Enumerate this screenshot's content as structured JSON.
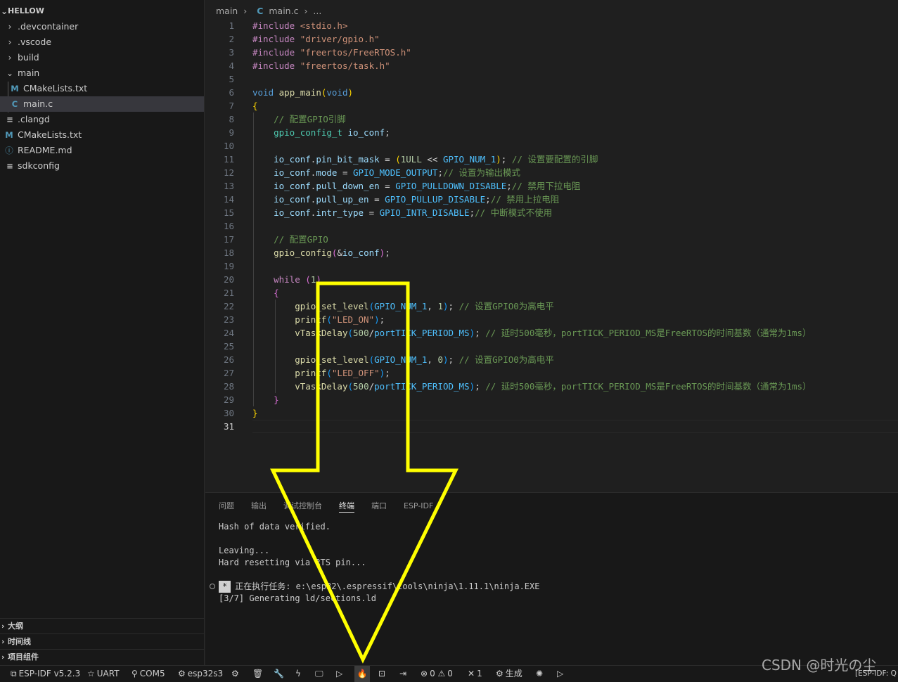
{
  "explorer": {
    "root": "HELLOW",
    "items": [
      {
        "label": ".devcontainer",
        "icon": "chevron-right"
      },
      {
        "label": ".vscode",
        "icon": "chevron-right"
      },
      {
        "label": "build",
        "icon": "chevron-right"
      },
      {
        "label": "main",
        "icon": "chevron-down"
      },
      {
        "label": "CMakeLists.txt",
        "icon": "M"
      },
      {
        "label": "main.c",
        "icon": "C"
      },
      {
        "label": ".clangd",
        "icon": "lines"
      },
      {
        "label": "CMakeLists.txt",
        "icon": "M"
      },
      {
        "label": "README.md",
        "icon": "info"
      },
      {
        "label": "sdkconfig",
        "icon": "lines"
      }
    ],
    "sections": [
      "大纲",
      "时间线",
      "项目组件"
    ]
  },
  "breadcrumb": {
    "folder": "main",
    "file": "main.c",
    "more": "..."
  },
  "editor": {
    "line_numbers": [
      "1",
      "2",
      "3",
      "4",
      "5",
      "6",
      "7",
      "8",
      "9",
      "10",
      "11",
      "12",
      "13",
      "14",
      "15",
      "16",
      "17",
      "18",
      "19",
      "20",
      "21",
      "22",
      "23",
      "24",
      "25",
      "26",
      "27",
      "28",
      "29",
      "30",
      "31"
    ],
    "tokens": {
      "l1": [
        "#include",
        " <stdio.h>"
      ],
      "l2": [
        "#include",
        " \"driver/gpio.h\""
      ],
      "l3": [
        "#include",
        " \"freertos/FreeRTOS.h\""
      ],
      "l4": [
        "#include",
        " \"freertos/task.h\""
      ],
      "l6": [
        "void",
        " ",
        "app_main",
        "(",
        "void",
        ")"
      ],
      "l7": [
        "{"
      ],
      "l8": [
        "// 配置GPIO引脚"
      ],
      "l9": [
        "gpio_config_t",
        " ",
        "io_conf",
        ";"
      ],
      "l11": [
        "io_conf",
        ".",
        "pin_bit_mask",
        " = ",
        "(",
        "1ULL",
        " << ",
        "GPIO_NUM_1",
        ")",
        "; ",
        "// 设置要配置的引脚"
      ],
      "l12": [
        "io_conf",
        ".",
        "mode",
        " = ",
        "GPIO_MODE_OUTPUT",
        ";",
        "// 设置为输出模式"
      ],
      "l13": [
        "io_conf",
        ".",
        "pull_down_en",
        " = ",
        "GPIO_PULLDOWN_DISABLE",
        ";",
        "// 禁用下拉电阻"
      ],
      "l14": [
        "io_conf",
        ".",
        "pull_up_en",
        " = ",
        "GPIO_PULLUP_DISABLE",
        ";",
        "// 禁用上拉电阻"
      ],
      "l15": [
        "io_conf",
        ".",
        "intr_type",
        " = ",
        "GPIO_INTR_DISABLE",
        ";",
        "// 中断模式不使用"
      ],
      "l17": [
        "// 配置GPIO"
      ],
      "l18": [
        "gpio_config",
        "(",
        "&",
        "io_conf",
        ")",
        ";"
      ],
      "l20": [
        "while",
        " ",
        "(",
        "1",
        ")"
      ],
      "l21": [
        "{"
      ],
      "l22": [
        "gpio_set_level",
        "(",
        "GPIO_NUM_1",
        ", ",
        "1",
        ")",
        "; ",
        "// 设置GPIO0为高电平"
      ],
      "l23": [
        "printf",
        "(",
        "\"LED_ON\"",
        ")",
        ";"
      ],
      "l24": [
        "vTaskDelay",
        "(",
        "500",
        "/",
        "portTICK_PERIOD_MS",
        ")",
        "; ",
        "// 延时500毫秒，portTICK_PERIOD_MS是FreeRTOS的时间基数（通常为1ms）"
      ],
      "l26": [
        "gpio_set_level",
        "(",
        "GPIO_NUM_1",
        ", ",
        "0",
        ")",
        "; ",
        "// 设置GPIO0为高电平"
      ],
      "l27": [
        "printf",
        "(",
        "\"LED_OFF\"",
        ")",
        ";"
      ],
      "l28": [
        "vTaskDelay",
        "(",
        "500",
        "/",
        "portTICK_PERIOD_MS",
        ")",
        "; ",
        "// 延时500毫秒，portTICK_PERIOD_MS是FreeRTOS的时间基数（通常为1ms）"
      ],
      "l29": [
        "}"
      ],
      "l30": [
        "}"
      ]
    }
  },
  "panel": {
    "tabs": [
      "问题",
      "输出",
      "调试控制台",
      "终端",
      "端口",
      "ESP-IDF"
    ],
    "active_tab": "终端",
    "terminal": {
      "line1": "Hash of data verified.",
      "line2": "Leaving...",
      "line3": "Hard resetting via RTS pin...",
      "task_badge": "*",
      "task_line": "正在执行任务: e:\\esp32\\.espressif\\tools\\ninja\\1.11.1\\ninja.EXE",
      "progress_line": "[3/7] Generating ld/sections.ld"
    }
  },
  "statusbar": {
    "idf_version": "ESP-IDF v5.2.3",
    "uart": "UART",
    "port": "COM5",
    "target": "esp32s3",
    "errors": "0",
    "warnings": "0",
    "tools_count": "1",
    "build_label": "生成",
    "right_text": "[ESP-IDF: Q"
  },
  "watermark": "CSDN @时光の尘",
  "colors": {
    "annotation_arrow": "#ffff00",
    "editor_bg": "#1f1f1f",
    "sidebar_bg": "#181818"
  }
}
